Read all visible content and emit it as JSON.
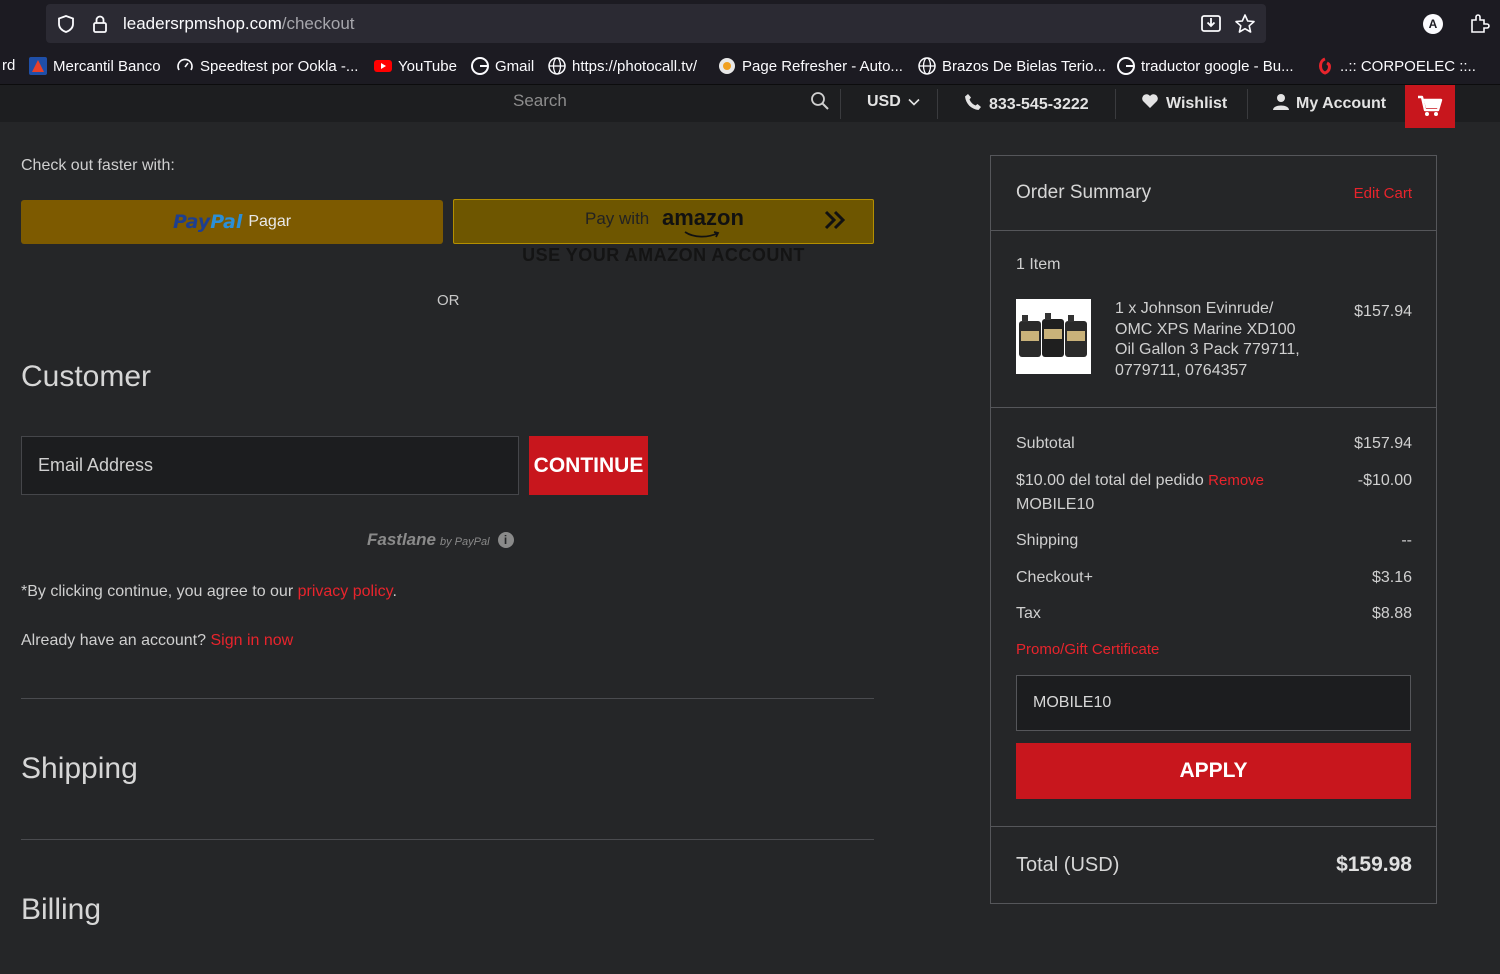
{
  "browser": {
    "url_domain": "leadersrpmshop.com",
    "url_path": "/checkout",
    "account_initial": "A",
    "bookmarks": [
      {
        "label": "rd",
        "icon": "none"
      },
      {
        "label": "Mercantil Banco",
        "icon": "mercantil-icon"
      },
      {
        "label": "Speedtest por Ookla -...",
        "icon": "speedtest-icon"
      },
      {
        "label": "YouTube",
        "icon": "youtube-icon"
      },
      {
        "label": "Gmail",
        "icon": "google-icon"
      },
      {
        "label": "https://photocall.tv/",
        "icon": "globe-icon"
      },
      {
        "label": "Page Refresher - Auto...",
        "icon": "refresher-icon"
      },
      {
        "label": "Brazos De Bielas Terio...",
        "icon": "globe-icon"
      },
      {
        "label": "traductor google - Bu...",
        "icon": "google-icon"
      },
      {
        "label": "..:: CORPOELEC ::..",
        "icon": "corpoelec-icon"
      }
    ]
  },
  "header": {
    "search_placeholder": "Search",
    "currency": "USD",
    "phone": "833-545-3222",
    "wishlist": "Wishlist",
    "account": "My Account"
  },
  "checkout": {
    "faster_label": "Check out faster with:",
    "paypal_pay": "Pay",
    "paypal_pal": "Pal",
    "paypal_label": "Pagar",
    "amazon_pay_with": "Pay with",
    "amazon_brand": "amazon",
    "amazon_sub": "USE YOUR AMAZON ACCOUNT",
    "or": "OR",
    "customer_heading": "Customer",
    "email_placeholder": "Email Address",
    "continue": "CONTINUE",
    "fastlane": "Fastlane",
    "fastlane_by": "by PayPal",
    "agree_text": "*By clicking continue, you agree to our ",
    "privacy_link": "privacy policy",
    "agree_end": ".",
    "have_account": "Already have an account? ",
    "sign_in": "Sign in now",
    "shipping_heading": "Shipping",
    "billing_heading": "Billing"
  },
  "summary": {
    "title": "Order Summary",
    "edit_cart": "Edit Cart",
    "item_count": "1 Item",
    "item_name": "1 x Johnson Evinrude/ OMC XPS Marine XD100 Oil Gallon 3 Pack 779711, 0779711, 0764357",
    "item_price": "$157.94",
    "subtotal_label": "Subtotal",
    "subtotal_value": "$157.94",
    "discount_label": "$10.00 del total del pedido",
    "discount_remove": "Remove",
    "discount_code": "MOBILE10",
    "discount_value": "-$10.00",
    "shipping_label": "Shipping",
    "shipping_value": "--",
    "checkoutplus_label": "Checkout+",
    "checkoutplus_value": "$3.16",
    "tax_label": "Tax",
    "tax_value": "$8.88",
    "promo_link": "Promo/Gift Certificate",
    "promo_value": "MOBILE10",
    "apply": "APPLY",
    "total_label": "Total (USD)",
    "total_value": "$159.98"
  },
  "colors": {
    "accent_red": "#c8161d",
    "link_red": "#e8242c",
    "paypal_yellow": "#7d5a00",
    "background": "#252628"
  }
}
